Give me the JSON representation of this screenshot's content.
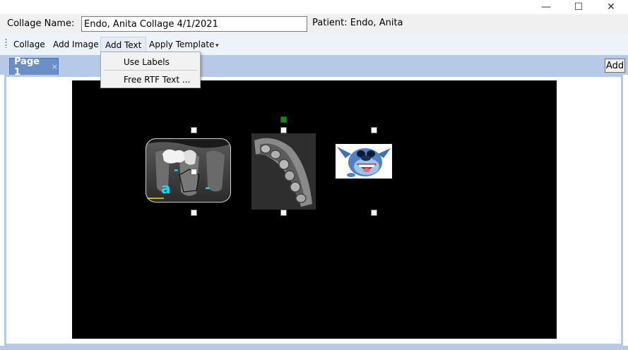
{
  "window": {
    "minimize_glyph": "—",
    "maximize_glyph": "☐",
    "close_glyph": "✕"
  },
  "collage": {
    "name_label": "Collage Name:",
    "name_value": "Endo, Anita Collage 4/1/2021",
    "patient_label": "Patient: Endo, Anita"
  },
  "toolbar": {
    "items": [
      "Collage",
      "Add Image",
      "Add Text",
      "Apply Template"
    ],
    "overflow_glyph": "▾"
  },
  "tabs": {
    "active_label": "Page 1",
    "close_glyph": "×",
    "add_label": "Add"
  },
  "add_text_menu": {
    "items": [
      "Use Labels",
      "Free RTF Text ..."
    ]
  },
  "xray_labels": {
    "letter_a": "a",
    "dash": "-"
  },
  "colors": {
    "canvas": "#000000",
    "tab_active": "#6b90c8",
    "tab_strip": "#b6c9e6",
    "rotation_handle": "#118a11",
    "annotation_cyan": "#00e5ff"
  }
}
